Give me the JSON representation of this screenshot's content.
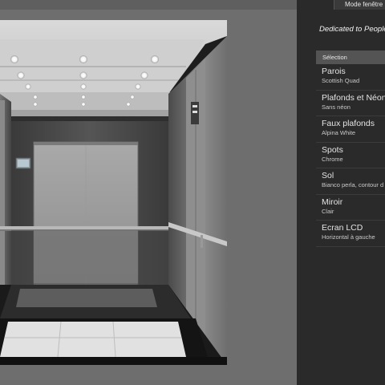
{
  "panel": {
    "mode_button": "Mode fenêtre",
    "tagline": "Dedicated to People",
    "selection_header": "Sélection",
    "items": [
      {
        "title": "Parois",
        "value": "Scottish Quad"
      },
      {
        "title": "Plafonds et Néons",
        "value": "Sans néon"
      },
      {
        "title": "Faux plafonds",
        "value": "Alpina White"
      },
      {
        "title": "Spots",
        "value": "Chrome"
      },
      {
        "title": "Sol",
        "value": "Bianco perla, contour d"
      },
      {
        "title": "Miroir",
        "value": "Clair"
      },
      {
        "title": "Ecran LCD",
        "value": "Horizontal à gauche"
      }
    ]
  },
  "colors": {
    "background": "#6e6e6e",
    "panel": "#2a2a2a",
    "selection_header": "#545454",
    "text": "#e4e4e4"
  }
}
